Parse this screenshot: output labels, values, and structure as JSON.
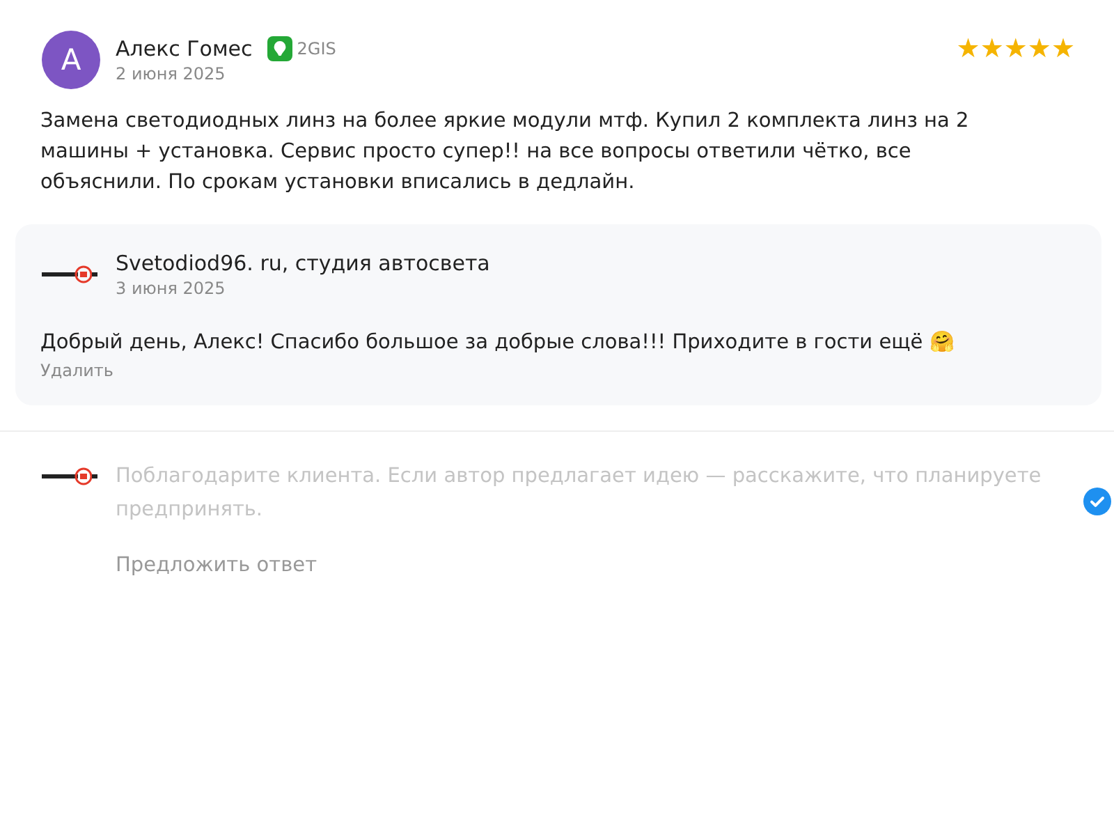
{
  "review": {
    "avatar_letter": "А",
    "author": "Алекс Гомес",
    "source": "2GIS",
    "date": "2 июня 2025",
    "stars": 5,
    "text": "Замена светодиодных линз на более яркие модули мтф. Купил 2 комплекта линз на 2 машины + установка. Сервис просто супер!! на все вопросы ответили чётко, все объяснили. По срокам установки вписались в дедлайн."
  },
  "reply": {
    "author": "Svetodiod96. ru, студия автосвета",
    "date": "3 июня 2025",
    "text": "Добрый день, Алекс! Спасибо большое за добрые слова!!! Приходите в гости ещё 🤗",
    "delete_label": "Удалить"
  },
  "composer": {
    "placeholder": "Поблагодарите клиента. Если автор предлагает идею — расскажите, что планируете предпринять.",
    "submit_label": "Предложить ответ"
  }
}
